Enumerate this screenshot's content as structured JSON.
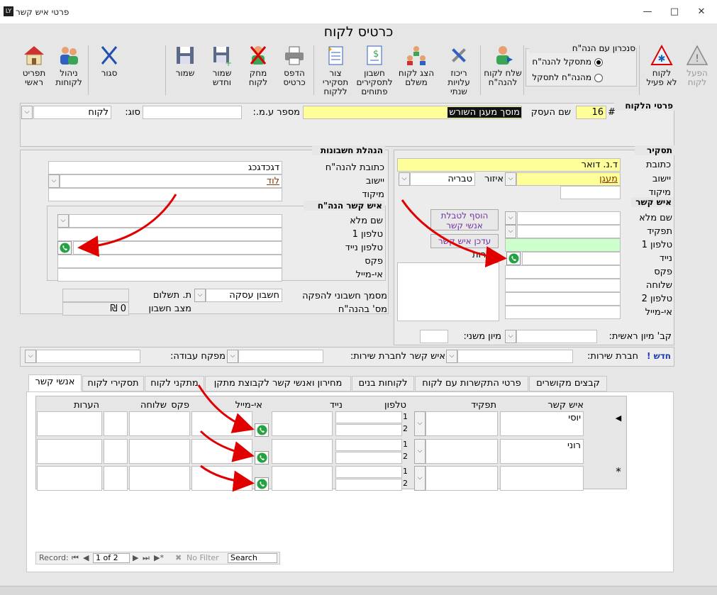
{
  "window": {
    "title": "פרטי איש קשר",
    "app_icon_text": "LY"
  },
  "form": {
    "title": "כרטיס לקוח"
  },
  "toolbar": {
    "activate": "הפעל\nלקוח",
    "inactive": "לקוח\nלא פעיל",
    "sync_title": "סנכרון עם הנה\"ח",
    "sync_opt1": "מתסקל להנה\"ח",
    "sync_opt2": "מהנה\"ח לתסקל",
    "send_to_accounting": "שלח לקוח\nלהנה\"ח",
    "cost_summary": "ריכוז\nעלויות\nשנתי",
    "show_payer": "הצג לקוח\nמשלם",
    "open_tax_invoices": "חשבון\nלתסקירים\nפתוחים",
    "attach_reports": "צור\nתסקירי\nללקוח",
    "print_cards": "הדפס\nכרטיס",
    "delete_customer": "מחק\nלקוח",
    "save_new": "שמור\nוחדש",
    "save": "שמור",
    "close": "סגור",
    "manage_customers": "ניהול\nלקוחות",
    "main_menu": "תפריט\nראשי"
  },
  "customer_details": {
    "section": "פרטי הלקוח",
    "hash_label": "#",
    "number": "16",
    "business_name_label": "שם העסק",
    "business_name": "מוסך מעגן השורש",
    "vat_label": "מספר ע.מ.:",
    "vat_value": "",
    "type_label": "סוג:",
    "type_value": "לקוח"
  },
  "report": {
    "section": "תסקיר",
    "address_label": "כתובת",
    "address": "ד.נ. דואר",
    "city_label": "יישוב",
    "city": "מעגן",
    "area_label": "איזור",
    "area": "טבריה",
    "zip_label": "מיקוד",
    "zip": ""
  },
  "accounting": {
    "section": "הנהלת חשבונות",
    "address_label": "כתובת להנה\"ח",
    "address": "דגכדגכג",
    "city_label": "יישוב",
    "city": "לוד",
    "zip_label": "מיקוד",
    "zip": ""
  },
  "acc_contact": {
    "section": "איש קשר הנה\"ח",
    "full_name": "שם מלא",
    "phone1": "טלפון 1",
    "mobile": "טלפון נייד",
    "fax": "פקס",
    "email": "אי-מייל"
  },
  "contact": {
    "section": "איש קשר",
    "full_name": "שם מלא",
    "role": "תפקיד",
    "phone1": "טלפון 1",
    "mobile": "נייד",
    "fax": "פקס",
    "ext": "שלוחה",
    "phone2": "טלפון 2",
    "email": "אי-מייל",
    "add_btn": "הוסף לטבלת\nאנשי קשר",
    "update_btn": "עדכן איש קשר",
    "notes_label": "הערות"
  },
  "payment": {
    "doc_label": "מסמך חשבוני להפקה",
    "doc_value": "חשבון עסקה",
    "terms_label": "ת. תשלום",
    "acc_no_label": "מס' בהנה\"ח",
    "balance_label": "מצב חשבון",
    "balance_value": "0 ₪"
  },
  "sort": {
    "main_label": "קב' מיון ראשית:",
    "secondary_label": "מיון משני:"
  },
  "service": {
    "new_label": "חדש !",
    "company_label": "חברת שירות:",
    "contact_label": "איש קשר לחברת שירות:",
    "supplier_label": "מפקח עבודה:"
  },
  "tabs": [
    {
      "label": "קבצים מקושרים"
    },
    {
      "label": "פרטי התקשרות עם לקוח"
    },
    {
      "label": "לקוחות בנים"
    },
    {
      "label": "מחירון ואנשי קשר לקבוצת מתקן"
    },
    {
      "label": "מתקני לקוח"
    },
    {
      "label": "תסקירי לקוח"
    },
    {
      "label": "אנשי קשר"
    }
  ],
  "grid": {
    "headers": [
      "איש קשר",
      "תפקיד",
      "טלפון",
      "נייד",
      "אי-מייל",
      "פקס",
      "שלוחה",
      "הערות"
    ],
    "rows": [
      {
        "name": "יוסי",
        "line1": "1",
        "line2": "2"
      },
      {
        "name": "רוני",
        "line1": "1",
        "line2": "2"
      },
      {
        "name": "",
        "line1": "1",
        "line2": "2"
      }
    ],
    "new_row_marker": "*",
    "current_row_marker": "◀"
  },
  "recordnav": {
    "label": "Record:",
    "position": "1 of 2",
    "filter": "No Filter",
    "search": "Search"
  },
  "colors": {
    "yellow": "#ffff99",
    "green": "#ccffcc",
    "arrow": "#e00000",
    "purple": "#7030a0"
  }
}
